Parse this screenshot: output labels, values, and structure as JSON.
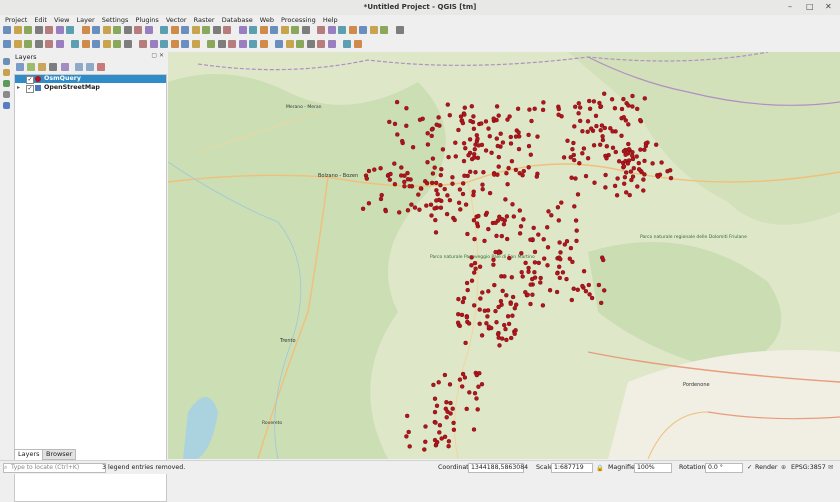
{
  "window": {
    "title": "*Untitled Project - QGIS [tm]",
    "minimize": "–",
    "maximize": "□",
    "close": "✕"
  },
  "menu": [
    "Project",
    "Edit",
    "View",
    "Layer",
    "Settings",
    "Plugins",
    "Vector",
    "Raster",
    "Database",
    "Web",
    "Processing",
    "Help"
  ],
  "layers_panel": {
    "title": "Layers",
    "layers": [
      {
        "name": "OsmQuery",
        "checked": true,
        "expanded": false,
        "selected": true,
        "icon": "point-layer-icon"
      },
      {
        "name": "OpenStreetMap",
        "checked": true,
        "expanded": true,
        "selected": false,
        "icon": "raster-layer-icon"
      }
    ],
    "tabs": [
      "Layers",
      "Browser"
    ]
  },
  "map": {
    "place_labels": [
      "Bolzano - Bozen",
      "Parco naturale Paneveggio Pale di San Martino",
      "Parco naturale regionale delle Dolomiti Friulane",
      "Pordenone",
      "Trento",
      "Merano - Meran",
      "Rovereto"
    ],
    "point_color": "#b3151c"
  },
  "statusbar": {
    "locator_placeholder": "Type to locate (Ctrl+K)",
    "message": "3 legend entries removed.",
    "coordinate_label": "Coordinate",
    "coordinate_value": "1344188,5863084",
    "scale_label": "Scale",
    "scale_value": "1:687719",
    "magnifier_label": "Magnifier",
    "magnifier_value": "100%",
    "rotation_label": "Rotation",
    "rotation_value": "0.0 °",
    "render_label": "Render",
    "crs": "EPSG:3857"
  }
}
